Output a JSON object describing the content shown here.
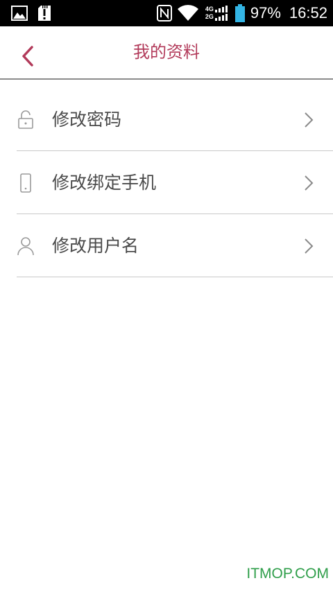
{
  "status_bar": {
    "battery": "97%",
    "time": "16:52",
    "network_top": "4G",
    "network_bottom": "2G",
    "icons_left": [
      "gallery-icon",
      "sd-card-alert-icon"
    ],
    "icons_right": [
      "nfc-icon",
      "wifi-icon",
      "signal-icon",
      "battery-icon"
    ]
  },
  "header": {
    "title": "我的资料",
    "back_icon": "chevron-left-icon",
    "accent_color": "#b23a5a"
  },
  "menu": {
    "items": [
      {
        "label": "修改密码",
        "icon": "unlock-icon"
      },
      {
        "label": "修改绑定手机",
        "icon": "phone-icon"
      },
      {
        "label": "修改用户名",
        "icon": "user-icon"
      }
    ],
    "chevron_icon": "chevron-right-icon"
  },
  "watermark": {
    "text": "ITMOP.COM",
    "color": "#2f9e4a"
  }
}
